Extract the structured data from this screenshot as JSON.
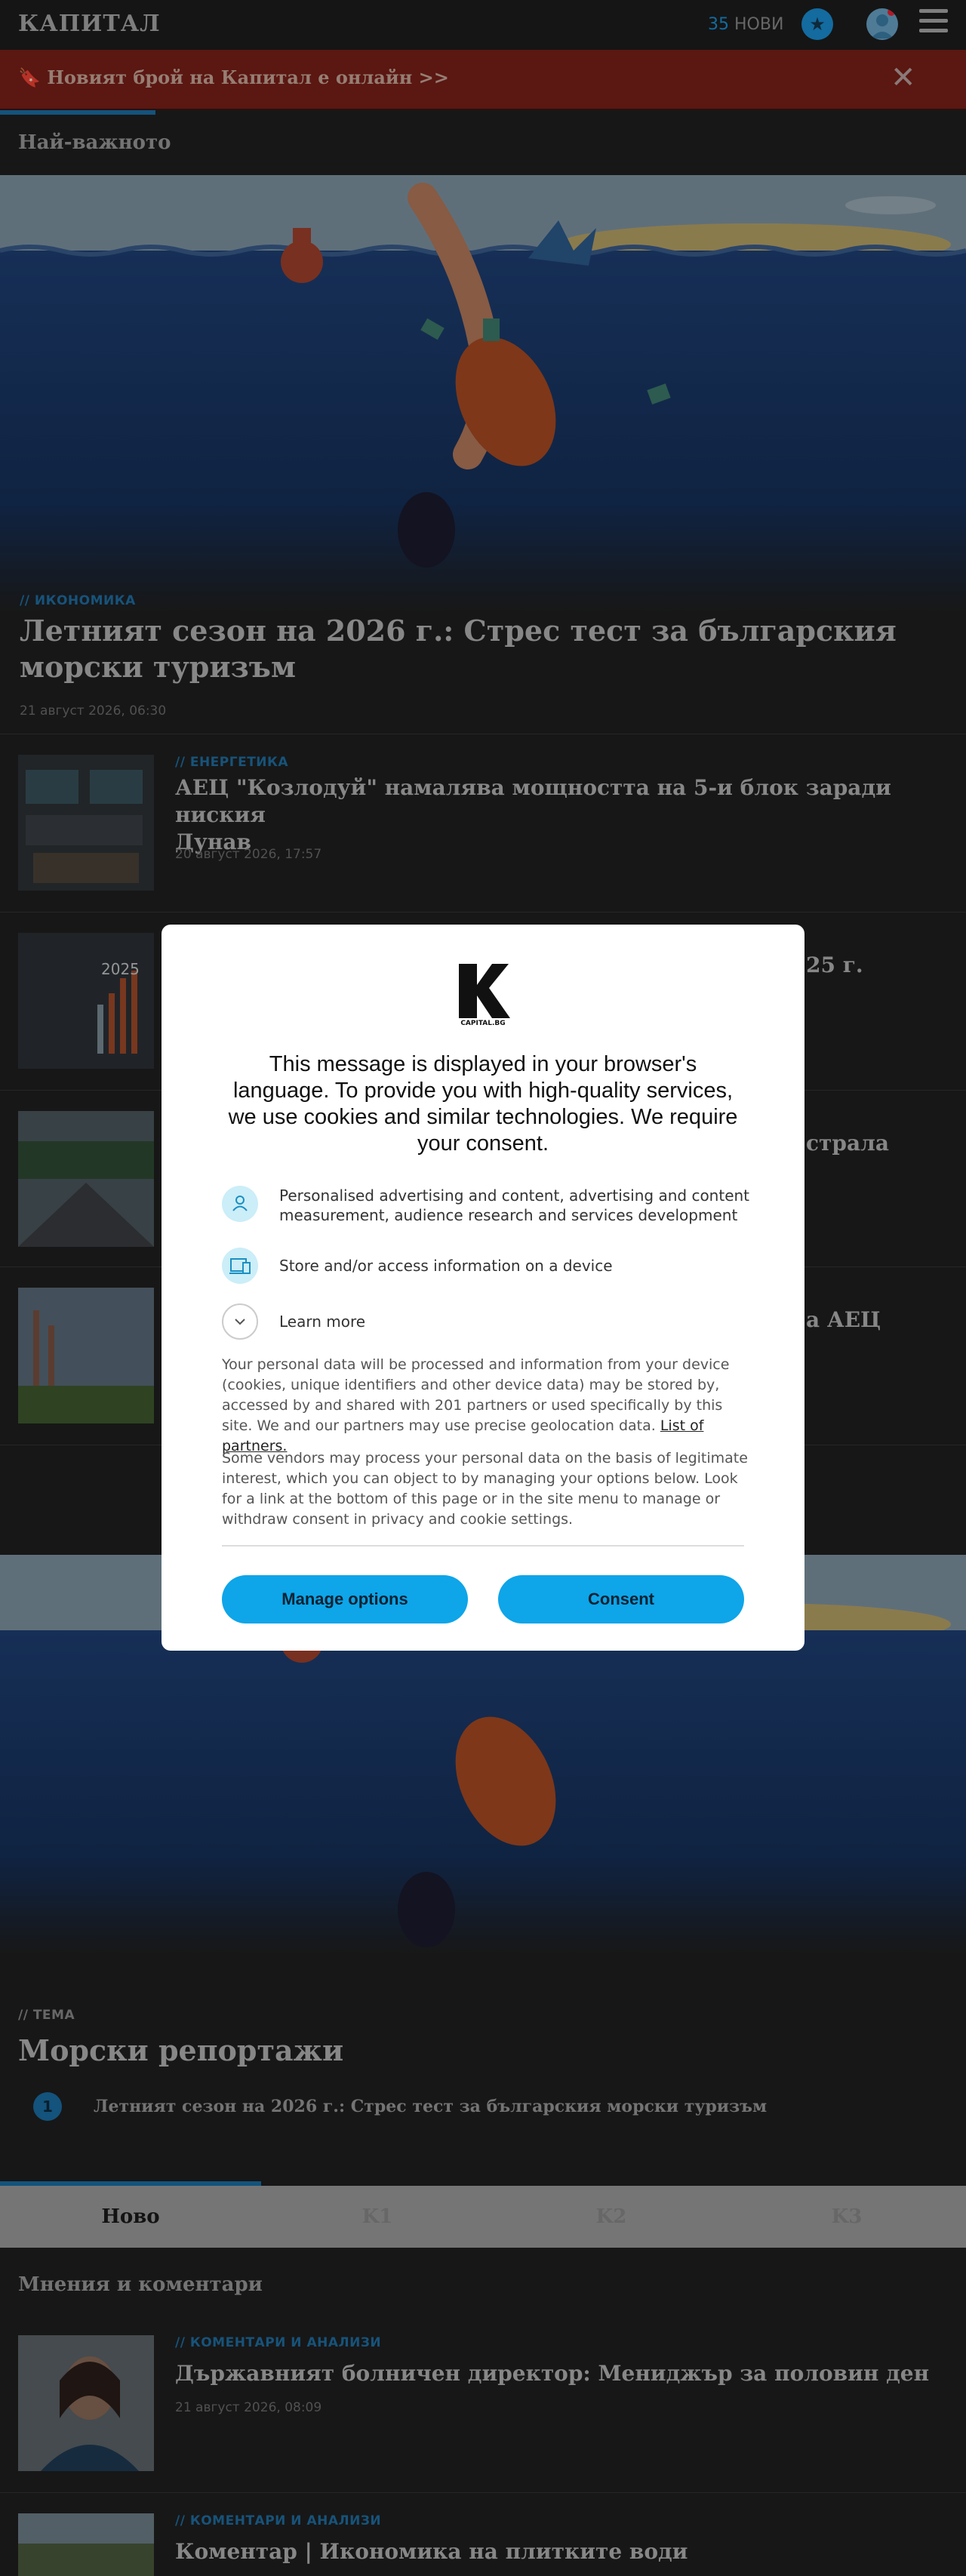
{
  "header": {
    "logo": "КАПИТАЛ",
    "new_count": "35",
    "new_label": "НОВИ"
  },
  "promo": {
    "text": "🔖 Новият брой на Капитал е онлайн >>",
    "close": "✕"
  },
  "top_section": {
    "title": "Най-важното"
  },
  "hero": {
    "category": "// ИКОНОМИКА",
    "title_line1": "Летният сезон на 2026 г.: Стрес тест за българския",
    "title_line2": "морски туризъм",
    "date": "21 август 2026, 06:30"
  },
  "articles": [
    {
      "category": "// ЕНЕРГЕТИКА",
      "title_line1": "АЕЦ \"Козлодуй\" намалява мощността на 5-и блок заради ниския",
      "title_line2": "Дунав",
      "date": "20 август 2026, 17:57"
    },
    {
      "title_partial": "25 г."
    },
    {
      "title_partial": "страла"
    },
    {
      "title_partial": "а АЕЦ"
    }
  ],
  "thumb2_label": "2025",
  "theme": {
    "category": "// ТЕМА",
    "title": "Морски репортажи",
    "items": [
      {
        "num": "1",
        "text": "Летният сезон на 2026 г.: Стрес тест за българския морски туризъм"
      }
    ]
  },
  "tabs": [
    "Ново",
    "K1",
    "K2",
    "K3"
  ],
  "opinions": {
    "title": "Мнения и коментари",
    "items": [
      {
        "category": "// КОМЕНТАРИ И АНАЛИЗИ",
        "title": "Държавният болничен директор: Мениджър за половин ден",
        "date": "21 август 2026, 08:09"
      },
      {
        "category": "// КОМЕНТАРИ И АНАЛИЗИ",
        "title": "Коментар | Икономика на плитките води"
      }
    ]
  },
  "consent": {
    "logo_text": "CAPITAL.BG",
    "title": "This message is displayed in your browser's language. To provide you with high-quality services, we use cookies and similar technologies. We require your consent.",
    "purposes": [
      "Personalised advertising and content, advertising and content measurement, audience research and services development",
      "Store and/or access information on a device",
      "Learn more"
    ],
    "body1": "Your personal data will be processed and information from your device (cookies, unique identifiers and other device data) may be stored by, accessed by and shared with 201 partners or used specifically by this site. We and our partners may use precise geolocation data.",
    "partners_link": "List of partners.",
    "body2": "Some vendors may process your personal data on the basis of legitimate interest, which you can object to by managing your options below. Look for a link at the bottom of this page or in the site menu to manage or withdraw consent in privacy and cookie settings.",
    "manage_button": "Manage options",
    "consent_button": "Consent"
  },
  "colors": {
    "accent": "#1a8fd4",
    "promo_bg": "#7a1f18",
    "button": "#0ea5e9"
  }
}
